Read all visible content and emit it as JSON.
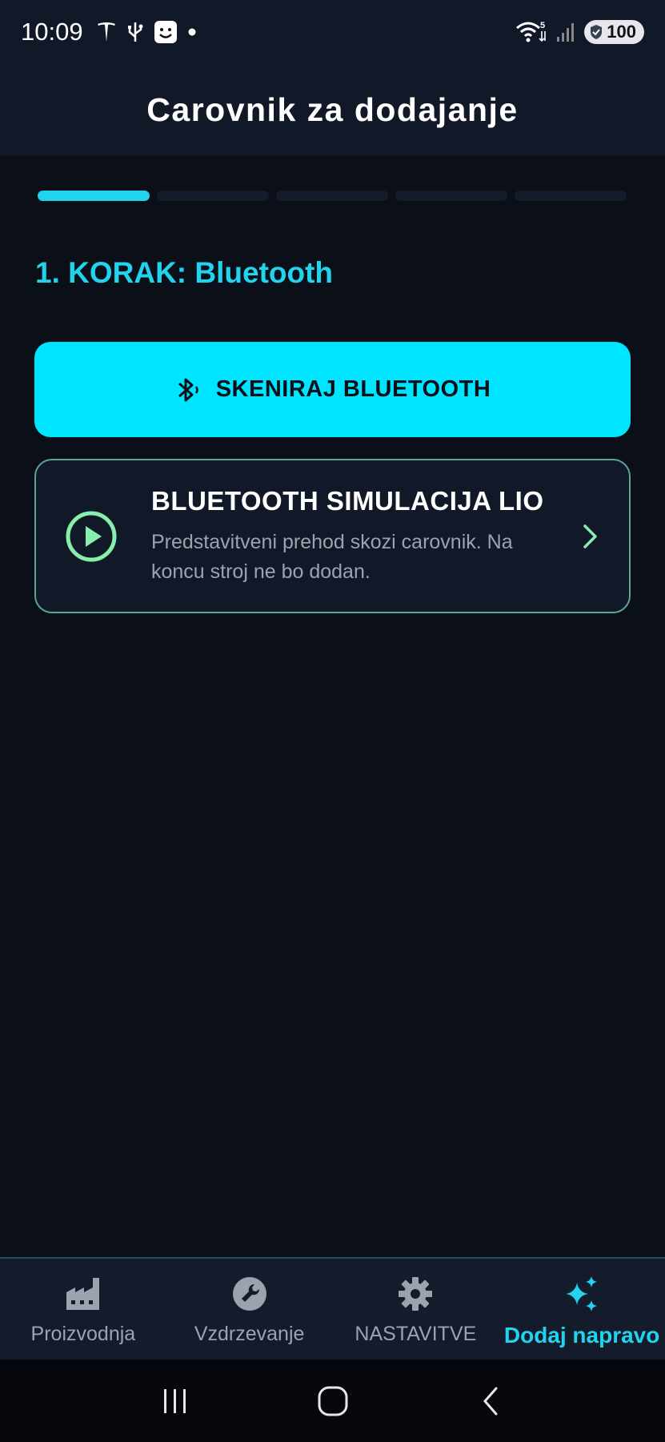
{
  "status_bar": {
    "time": "10:09",
    "wifi_badge": "5",
    "battery": "100"
  },
  "app_bar": {
    "title": "Carovnik za dodajanje"
  },
  "wizard": {
    "total_steps": 5,
    "current_step": 1,
    "step_title": "1. KORAK: Bluetooth",
    "scan_button": {
      "label": "SKENIRAJ BLUETOOTH",
      "icon": "bluetooth-searching-icon"
    },
    "simulation_card": {
      "title": "BLUETOOTH SIMULACIJA LIO",
      "description": "Predstavitveni prehod skozi carovnik. Na koncu stroj ne bo dodan.",
      "icon": "play-circle-icon",
      "trailing_icon": "chevron-right-icon"
    }
  },
  "bottom_nav": {
    "items": [
      {
        "label": "Proizvodnja",
        "icon": "factory-icon",
        "active": false
      },
      {
        "label": "Vzdrzevanje",
        "icon": "wrench-icon",
        "active": false
      },
      {
        "label": "NASTAVITVE",
        "icon": "gear-icon",
        "active": false
      },
      {
        "label": "Dodaj napravo",
        "icon": "sparkles-icon",
        "active": true
      }
    ]
  },
  "colors": {
    "accent": "#22d3ee",
    "button_bg": "#00e5ff",
    "card_border": "#5aa59a",
    "play_icon": "#86efac",
    "background": "#0b0f17",
    "surface": "#111827"
  }
}
